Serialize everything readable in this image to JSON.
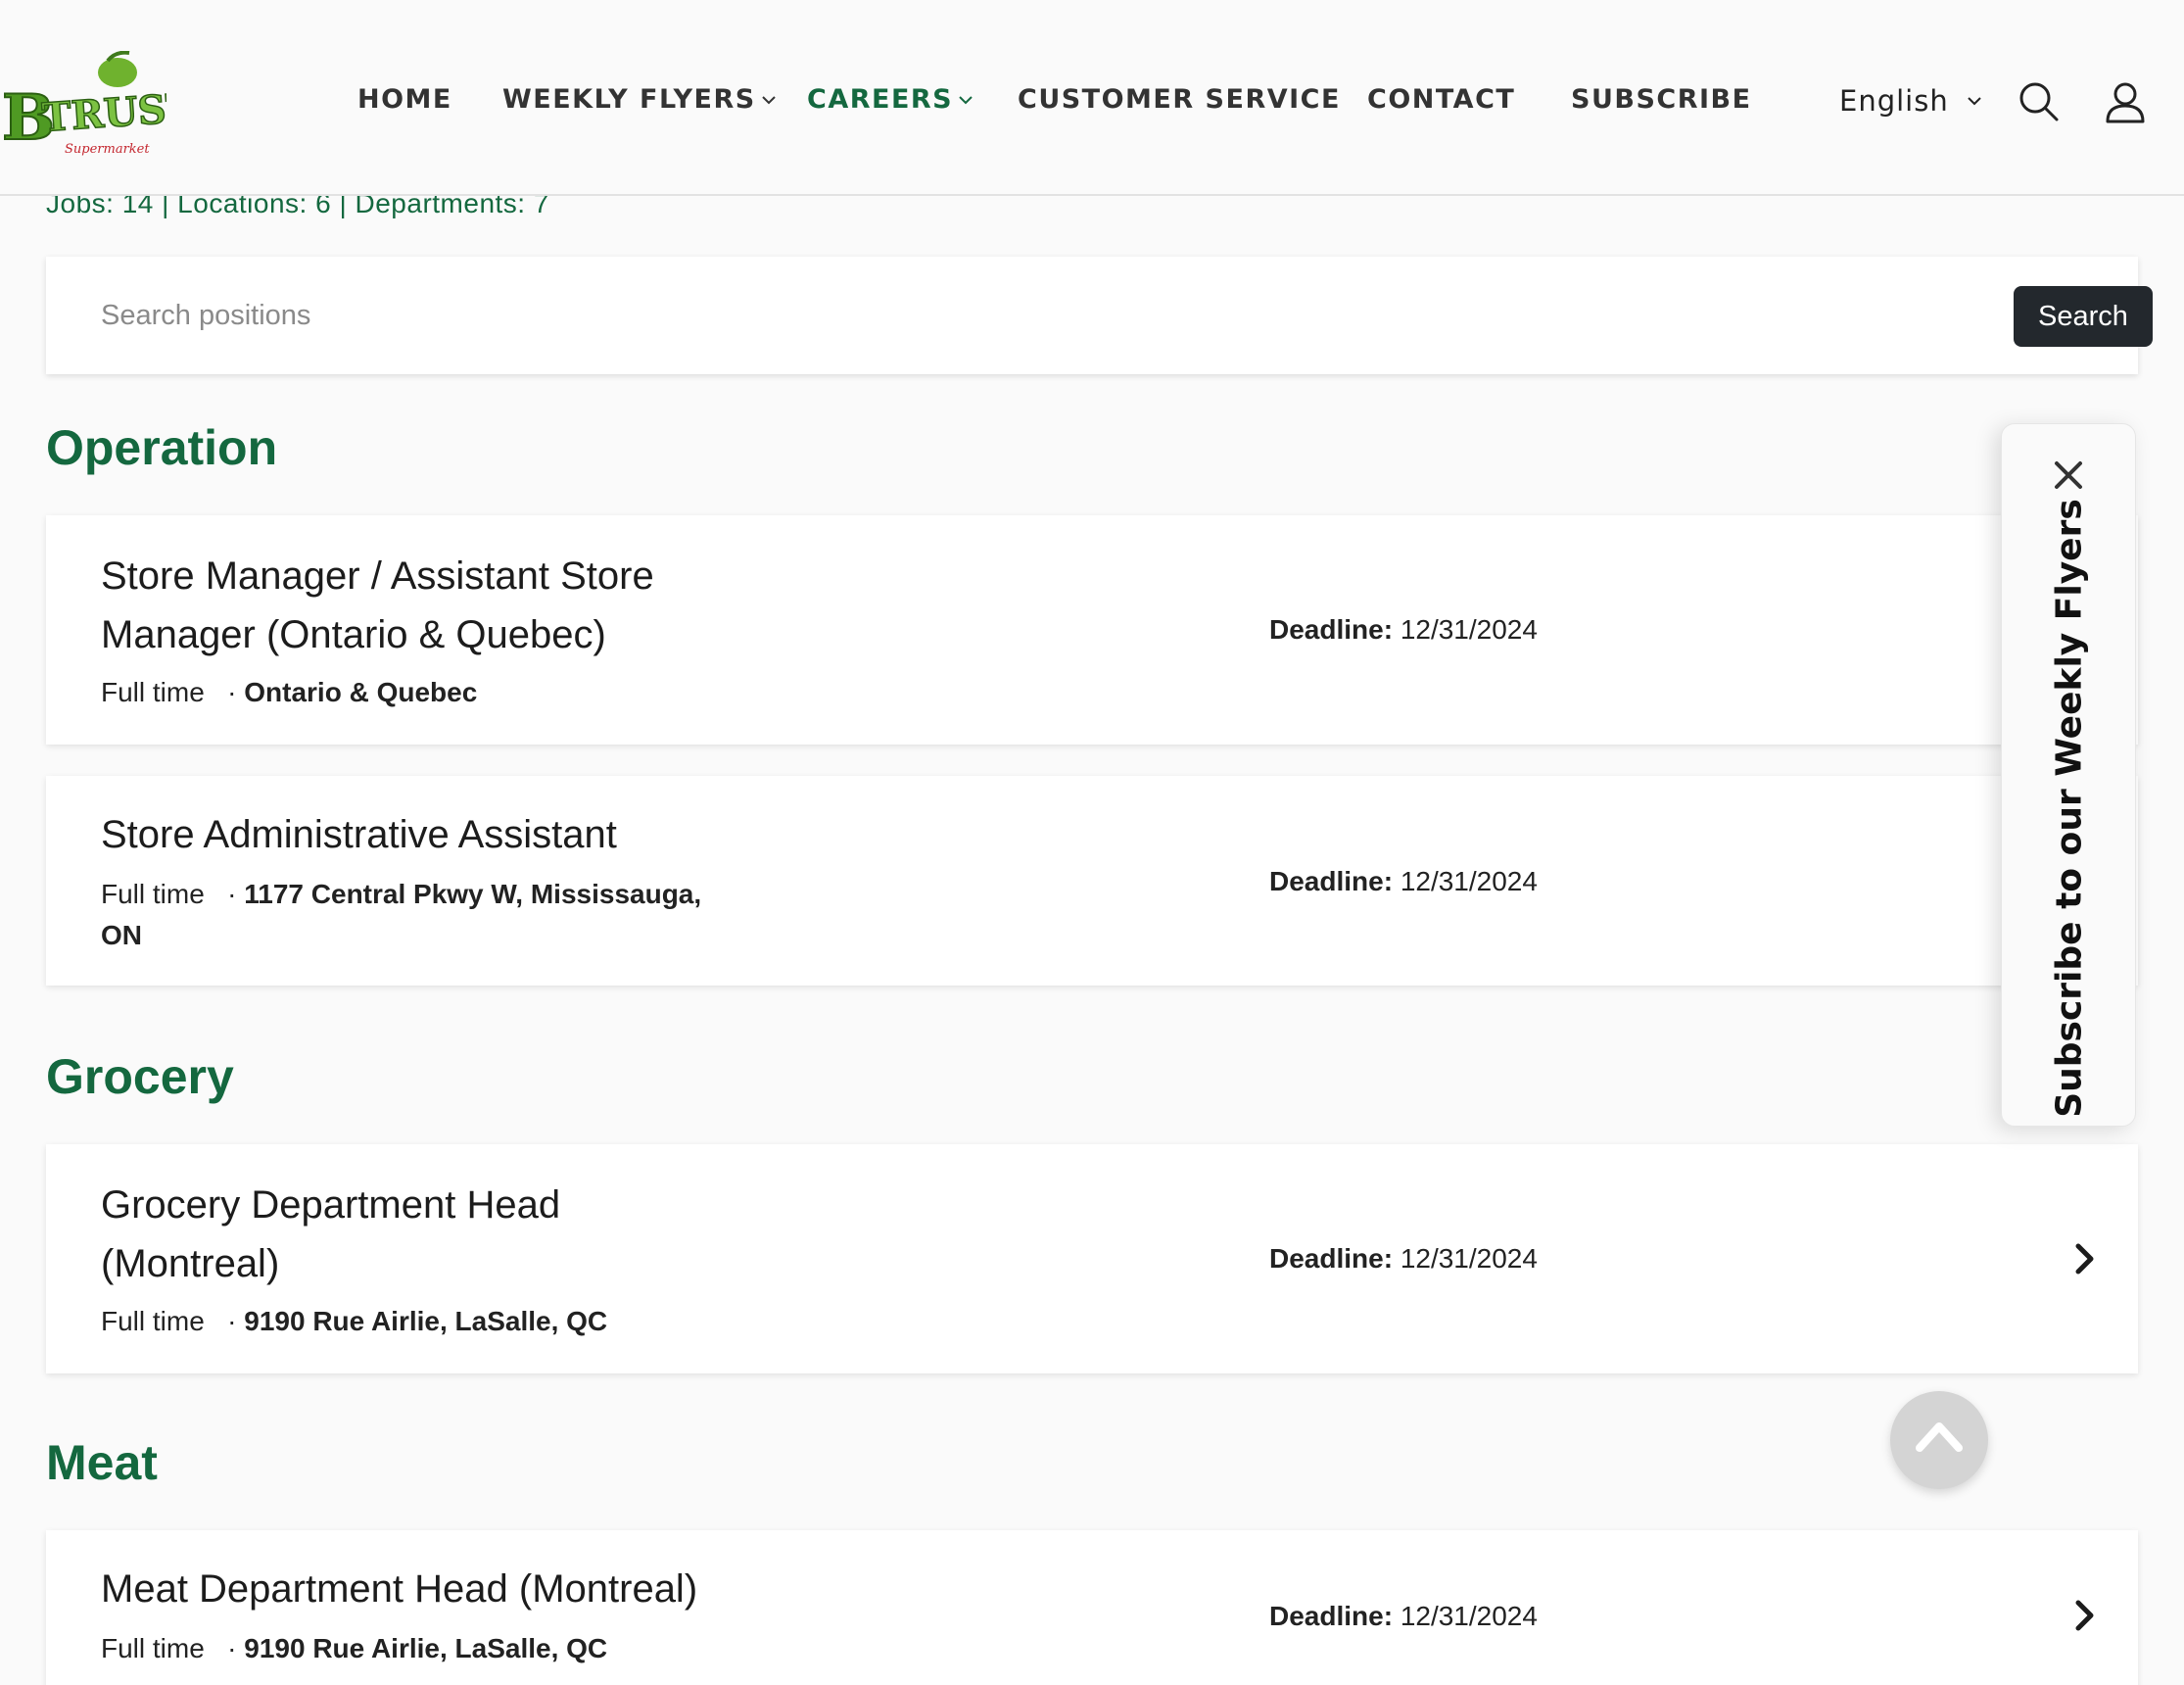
{
  "logo": {
    "text": "BTRUST",
    "subtext": "Supermarket"
  },
  "nav": {
    "items": [
      {
        "label": "HOME"
      },
      {
        "label": "WEEKLY FLYERS"
      },
      {
        "label": "CAREERS"
      },
      {
        "label": "CUSTOMER SERVICE"
      },
      {
        "label": "CONTACT"
      },
      {
        "label": "SUBSCRIBE"
      }
    ],
    "active": "CAREERS",
    "language": "English",
    "icons": [
      "search-icon",
      "user-icon",
      "chevron-down-icon"
    ]
  },
  "stats": "Jobs: 14 | Locations: 6 | Departments: 7",
  "search": {
    "placeholder": "Search positions",
    "value": "",
    "button_label": "Search"
  },
  "sections": [
    {
      "title": "Operation",
      "jobs": [
        {
          "title": "Store Manager / Assistant Store Manager (Ontario & Quebec)",
          "type": "Full time",
          "location": "Ontario & Quebec",
          "deadline_label": "Deadline:",
          "deadline": "12/31/2024"
        },
        {
          "title": "Store Administrative Assistant",
          "type": "Full time",
          "location": "1177 Central Pkwy W, Mississauga, ON",
          "deadline_label": "Deadline:",
          "deadline": "12/31/2024"
        }
      ]
    },
    {
      "title": "Grocery",
      "jobs": [
        {
          "title": "Grocery Department Head (Montreal)",
          "type": "Full time",
          "location": "9190 Rue Airlie, LaSalle, QC",
          "deadline_label": "Deadline:",
          "deadline": "12/31/2024"
        }
      ]
    },
    {
      "title": "Meat",
      "jobs": [
        {
          "title": "Meat Department Head (Montreal)",
          "type": "Full time",
          "location": "9190 Rue Airlie, LaSalle, QC",
          "deadline_label": "Deadline:",
          "deadline": "12/31/2024"
        }
      ]
    }
  ],
  "subscribe_panel": {
    "text": "Subscribe to our Weekly Flyers"
  },
  "colors": {
    "brand_green": "#14683f",
    "button_dark": "#23282d",
    "background": "#fafafa"
  }
}
